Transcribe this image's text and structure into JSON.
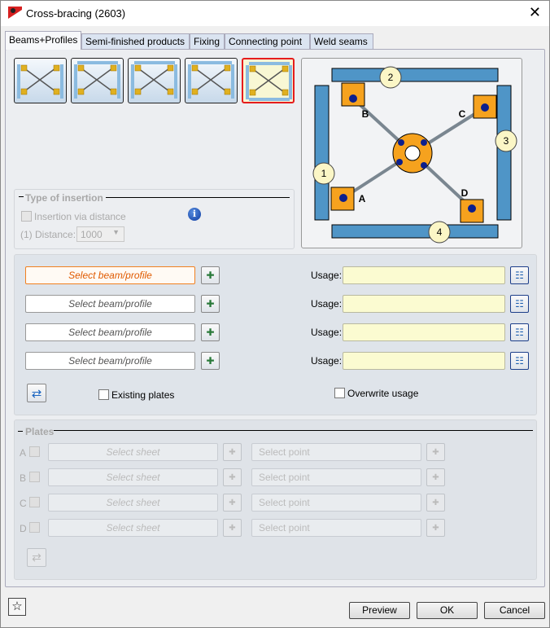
{
  "window": {
    "title": "Cross-bracing (2603)",
    "close": "✕"
  },
  "tabs": [
    {
      "label": "Beams+Profiles"
    },
    {
      "label": "Semi-finished products"
    },
    {
      "label": "Fixing"
    },
    {
      "label": "Connecting point"
    },
    {
      "label": "Weld seams"
    }
  ],
  "layouts": {
    "selected_index": 4,
    "count": 5
  },
  "diagram": {
    "numbers": [
      "1",
      "2",
      "3",
      "4"
    ],
    "letters": [
      "A",
      "B",
      "C",
      "D"
    ],
    "colors": {
      "beam": "#4f95c7",
      "plate": "#f6a21e",
      "dot": "#0c1f8c",
      "bar": "#7a8690"
    }
  },
  "insertion": {
    "title": "Type of insertion",
    "checkbox_label": "Insertion via distance",
    "distance_label": "(1) Distance:",
    "distance_value": "1000"
  },
  "beams": {
    "rows": [
      {
        "placeholder": "Select beam/profile",
        "usage_label": "Usage:",
        "usage_value": ""
      },
      {
        "placeholder": "Select beam/profile",
        "usage_label": "Usage:",
        "usage_value": ""
      },
      {
        "placeholder": "Select beam/profile",
        "usage_label": "Usage:",
        "usage_value": ""
      },
      {
        "placeholder": "Select beam/profile",
        "usage_label": "Usage:",
        "usage_value": ""
      }
    ],
    "existing_plates": "Existing plates",
    "overwrite_usage": "Overwrite usage"
  },
  "plates": {
    "title": "Plates",
    "rows": [
      {
        "letter": "A",
        "sheet": "Select sheet",
        "point": "Select point"
      },
      {
        "letter": "B",
        "sheet": "Select sheet",
        "point": "Select point"
      },
      {
        "letter": "C",
        "sheet": "Select sheet",
        "point": "Select point"
      },
      {
        "letter": "D",
        "sheet": "Select sheet",
        "point": "Select point"
      }
    ]
  },
  "footer": {
    "preview": "Preview",
    "ok": "OK",
    "cancel": "Cancel",
    "star": "☆"
  }
}
